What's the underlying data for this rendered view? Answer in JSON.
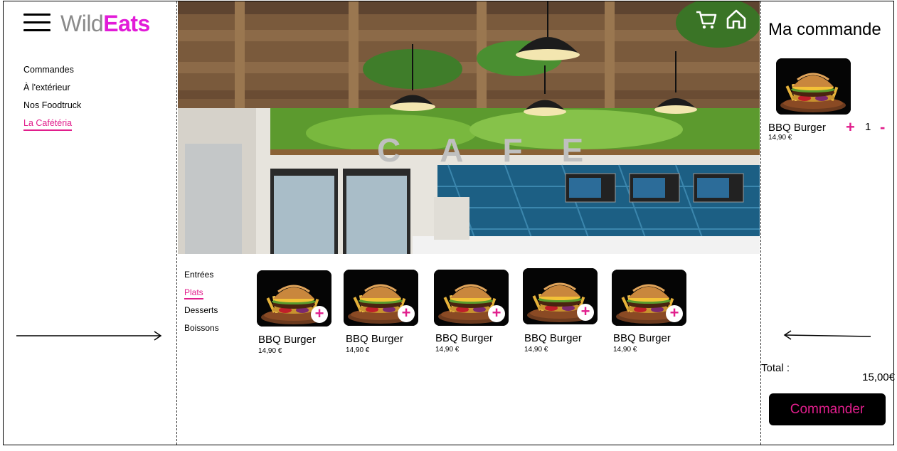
{
  "brand": {
    "part1": "Wild",
    "part2": "Eats"
  },
  "nav": [
    {
      "label": "Commandes",
      "active": false
    },
    {
      "label": "À l'extérieur",
      "active": false
    },
    {
      "label": "Nos Foodtruck",
      "active": false
    },
    {
      "label": "La Cafétéria",
      "active": true
    }
  ],
  "hero": {
    "sign": "CAFE"
  },
  "categories": [
    {
      "label": "Entrées",
      "active": false
    },
    {
      "label": "Plats",
      "active": true
    },
    {
      "label": "Desserts",
      "active": false
    },
    {
      "label": "Boissons",
      "active": false
    }
  ],
  "products": [
    {
      "name": "BBQ Burger",
      "price": "14,90 €"
    },
    {
      "name": "BBQ Burger",
      "price": "14,90 €"
    },
    {
      "name": "BBQ Burger",
      "price": "14,90 €"
    },
    {
      "name": "BBQ Burger",
      "price": "14,90 €"
    },
    {
      "name": "BBQ Burger",
      "price": "14,90 €"
    }
  ],
  "order": {
    "title": "Ma commande",
    "item": {
      "name": "BBQ Burger",
      "price": "14,90 €",
      "qty": "1"
    },
    "plus": "+",
    "minus": "-",
    "total_label": "Total :",
    "total_value": "15,00€",
    "button": "Commander"
  },
  "icons": {
    "cart": "cart-icon",
    "home": "home-icon",
    "add": "plus-icon"
  },
  "colors": {
    "accent": "#e11e8c",
    "logo_accent": "#e21bd8",
    "logo_grey": "#8a8a8a"
  }
}
